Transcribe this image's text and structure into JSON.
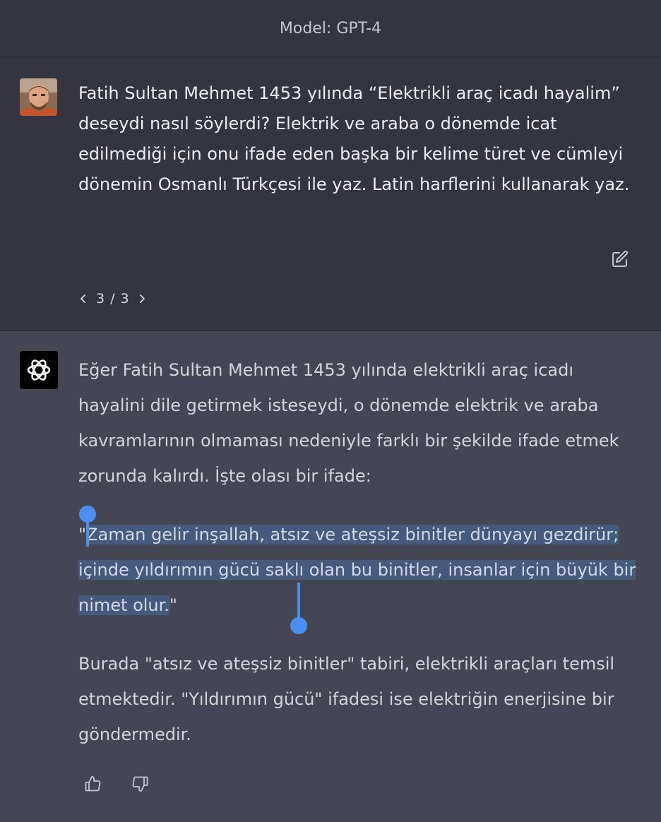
{
  "header": {
    "model_label": "Model: GPT-4"
  },
  "user_message": {
    "avatar_icon": "user-avatar-photo",
    "text": "Fatih Sultan Mehmet 1453 yılında “Elektrikli araç icadı hayalim” deseydi nasıl söylerdi? Elektrik ve araba o dönemde icat edilmediği için onu ifade eden başka bir kelime türet ve cümleyi dönemin Osmanlı Türkçesi ile yaz. Latin harflerini kullanarak yaz.",
    "edit_icon": "edit-icon",
    "pager": {
      "current": "3",
      "separator": "/",
      "total": "3"
    }
  },
  "assistant_message": {
    "logo_icon": "openai-logo-icon",
    "paragraph_1": "Eğer Fatih Sultan Mehmet 1453 yılında elektrikli araç icadı hayalini dile getirmek isteseydi, o dönemde elektrik ve araba kavramlarının olmaması nedeniyle farklı bir şekilde ifade etmek zorunda kalırdı. İşte olası bir ifade:",
    "quote_open": "\"",
    "quote_selected": "Zaman gelir inşallah, atsız ve ateşsiz binitler dünyayı gezdirür; içinde yıldırımın gücü saklı olan bu binitler, insanlar için büyük bir nimet olur.",
    "quote_close": "\"",
    "paragraph_3": "Burada \"atsız ve ateşsiz binitler\" tabiri, elektrikli araçları temsil etmektedir. \"Yıldırımın gücü\" ifadesi ise elektriğin enerjisine bir göndermedir.",
    "feedback": {
      "thumbs_up_icon": "thumbs-up-icon",
      "thumbs_down_icon": "thumbs-down-icon"
    }
  },
  "colors": {
    "header_bg": "#343541",
    "user_bg": "#343541",
    "assistant_bg": "#444654",
    "selection_highlight": "#455a7c",
    "selection_handle": "#4a90f0"
  }
}
